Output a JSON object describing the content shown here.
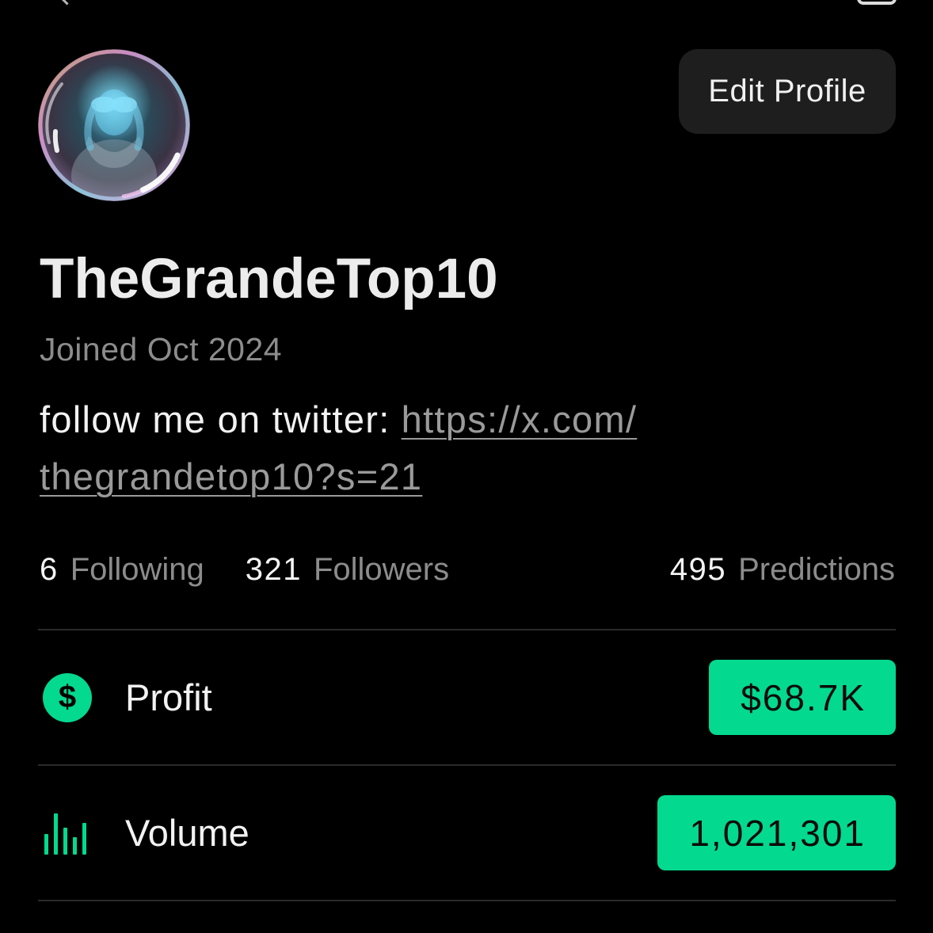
{
  "header": {
    "edit_profile_label": "Edit Profile"
  },
  "profile": {
    "username": "TheGrandeTop10",
    "joined": "Joined Oct 2024",
    "bio": {
      "text": "follow me on twitter:",
      "link_line1": "https://x.com/",
      "link_line2": "thegrandetop10?s=21"
    }
  },
  "stats": {
    "following": {
      "count": "6",
      "label": "Following"
    },
    "followers": {
      "count": "321",
      "label": "Followers"
    },
    "predictions": {
      "count": "495",
      "label": "Predictions"
    }
  },
  "metrics": [
    {
      "label": "Profit",
      "value": "$68.7K",
      "icon": "dollar-circle-icon",
      "icon_glyph": "$"
    },
    {
      "label": "Volume",
      "value": "1,021,301",
      "icon": "bar-chart-icon"
    }
  ],
  "icons": {
    "back": "back-icon",
    "header_right": "header-right-icon",
    "avatar": "avatar-image"
  },
  "colors": {
    "background": "#000000",
    "text": "#f2f2f2",
    "heading": "#ececec",
    "muted": "#8c8c8c",
    "link": "#9a9a9a",
    "accent": "#03d98f",
    "badge_text": "#0b0b0b",
    "button_bg": "#1e1e1e",
    "divider": "#2a2a2a"
  }
}
